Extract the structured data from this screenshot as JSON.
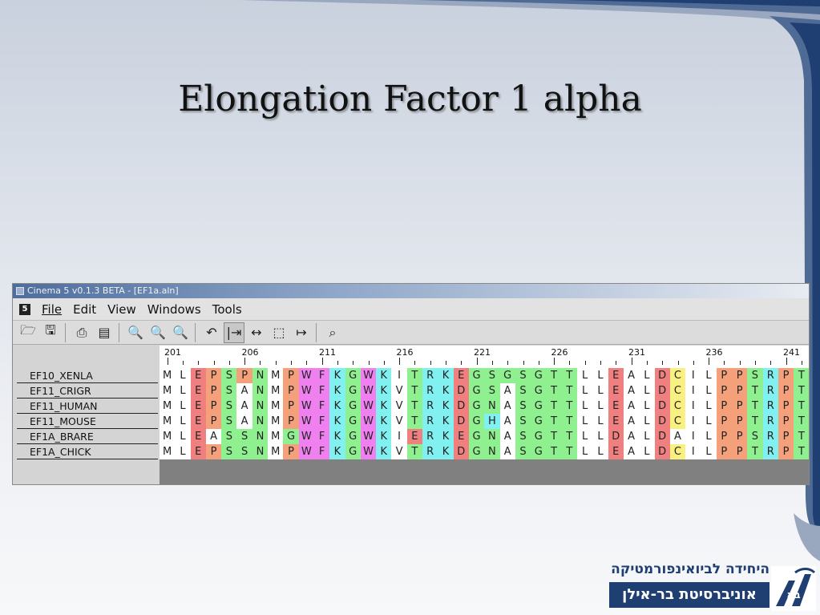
{
  "slide": {
    "title": "Elongation Factor 1 alpha"
  },
  "window": {
    "title": "Cinema 5  v0.1.3 BETA - [EF1a.aln]",
    "menu": [
      "File",
      "Edit",
      "View",
      "Windows",
      "Tools"
    ],
    "toolbar_icons": [
      "open-icon",
      "save-icon",
      "print-icon",
      "export-icon",
      "zoom-in-icon",
      "zoom-fit-icon",
      "zoom-out-icon",
      "undo-icon",
      "insert-gap-icon",
      "slide-icon",
      "select-block-icon",
      "move-right-icon",
      "find-icon"
    ]
  },
  "alignment": {
    "ruler": [
      {
        "label": "201",
        "col": 0
      },
      {
        "label": "206",
        "col": 5
      },
      {
        "label": "211",
        "col": 10
      },
      {
        "label": "216",
        "col": 15
      },
      {
        "label": "221",
        "col": 20
      },
      {
        "label": "226",
        "col": 25
      },
      {
        "label": "231",
        "col": 30
      },
      {
        "label": "236",
        "col": 35
      },
      {
        "label": "241",
        "col": 40
      }
    ],
    "sequences": [
      {
        "name": "EF10_XENLA",
        "residues": "MLEPSPNMPWFKGWKITRKEGSGSGTTLLEALDCILPPSRPT"
      },
      {
        "name": "EF11_CRIGR",
        "residues": "MLEPSANMPWFKGWKVTRKDGSASGTTLLEALDCILPPTRPT"
      },
      {
        "name": "EF11_HUMAN",
        "residues": "MLEPSANMPWFKGWKVTRKDGNASGTTLLEALDCILPPTRPT"
      },
      {
        "name": "EF11_MOUSE",
        "residues": "MLEPSANMPWFKGWKVTRKDGHASGTTLLEALDCILPPTRPT"
      },
      {
        "name": "EF1A_BRARE",
        "residues": "MLEASSNMGWFKGWKIERKEGNASGTTLLDALDAILPPSRPT"
      },
      {
        "name": "EF1A_CHICK",
        "residues": "MLEPSSNMPWFKGWKVTRKDGNASGTTLLEALDCILPPTRPT"
      }
    ],
    "residue_colors": {
      "E": "#f08080",
      "D": "#f08080",
      "P": "#f4a07a",
      "S": "#8ef08e",
      "T": "#8ef08e",
      "G": "#8ef08e",
      "N": "#8ef08e",
      "K": "#80f0f0",
      "R": "#80f0f0",
      "H": "#80f0f0",
      "W": "#f080f0",
      "F": "#f080f0",
      "Y": "#f080f0",
      "C": "#f8f080",
      "M": "#ffffff",
      "L": "#ffffff",
      "A": "#ffffff",
      "I": "#ffffff",
      "V": "#ffffff"
    }
  },
  "logo": {
    "line1": "היחידה לביואינפורמטיקה",
    "line2": "אוניברסיטת בר-אילן",
    "mark": "בא"
  }
}
